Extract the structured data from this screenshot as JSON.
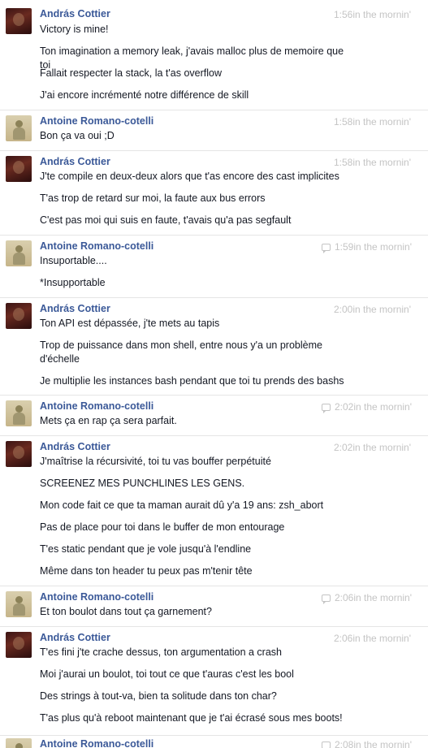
{
  "conversation": [
    {
      "author": "András Cottier",
      "avatar": "andras",
      "time": "1:56in the mornin'",
      "icon": false,
      "messages": [
        "Victory is mine!",
        "Ton imagination a memory leak, j'avais malloc plus de memoire que toi",
        "Fallait respecter la stack, la t'as overflow",
        "J'ai encore incrémenté notre différence de skill"
      ]
    },
    {
      "author": "Antoine Romano-cotelli",
      "avatar": "antoine",
      "time": "1:58in the mornin'",
      "icon": false,
      "messages": [
        "Bon ça va oui ;D"
      ]
    },
    {
      "author": "András Cottier",
      "avatar": "andras",
      "time": "1:58in the mornin'",
      "icon": false,
      "messages": [
        "J'te compile en deux-deux alors que t'as encore des cast implicites",
        "T'as trop de retard sur moi, la faute aux bus errors",
        "C'est pas moi qui suis en faute, t'avais qu'a pas segfault"
      ]
    },
    {
      "author": "Antoine Romano-cotelli",
      "avatar": "antoine",
      "time": "1:59in the mornin'",
      "icon": true,
      "messages": [
        "Insuportable....",
        "*Insupportable"
      ]
    },
    {
      "author": "András Cottier",
      "avatar": "andras",
      "time": "2:00in the mornin'",
      "icon": false,
      "messages": [
        "Ton API est dépassée, j'te mets au tapis",
        "Trop de puissance dans mon shell, entre nous y'a un problème d'échelle",
        "Je multiplie les instances bash pendant que toi tu prends des bashs"
      ]
    },
    {
      "author": "Antoine Romano-cotelli",
      "avatar": "antoine",
      "time": "2:02in the mornin'",
      "icon": true,
      "messages": [
        "Mets ça en rap ça sera parfait."
      ]
    },
    {
      "author": "András Cottier",
      "avatar": "andras",
      "time": "2:02in the mornin'",
      "icon": false,
      "messages": [
        "J'maîtrise la récursivité, toi tu vas bouffer perpétuité",
        "SCREENEZ MES PUNCHLINES LES GENS.",
        "Mon code fait ce que ta maman aurait dû y'a 19 ans: zsh_abort",
        "Pas de place pour toi dans le buffer de mon entourage",
        "T'es static pendant que je vole jusqu'à l'endline",
        "Même dans ton header tu peux pas m'tenir tête"
      ]
    },
    {
      "author": "Antoine Romano-cotelli",
      "avatar": "antoine",
      "time": "2:06in the mornin'",
      "icon": true,
      "messages": [
        "Et ton boulot dans tout ça garnement?"
      ]
    },
    {
      "author": "András Cottier",
      "avatar": "andras",
      "time": "2:06in the mornin'",
      "icon": false,
      "messages": [
        "T'es fini j'te crache dessus, ton argumentation a crash",
        "Moi j'aurai un boulot, toi tout ce que t'auras c'est les bool",
        "Des strings à tout-va, bien ta solitude dans ton char?",
        "T'as plus qu'à reboot maintenant que je t'ai écrasé sous mes boots!"
      ]
    },
    {
      "author": "Antoine Romano-cotelli",
      "avatar": "antoine",
      "time": "2:08in the mornin'",
      "icon": true,
      "messages": []
    }
  ]
}
